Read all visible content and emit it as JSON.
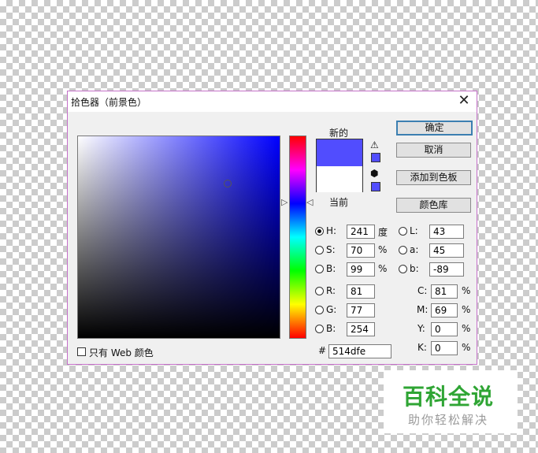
{
  "dialog": {
    "title": "拾色器（前景色）",
    "close_symbol": "✕"
  },
  "swatch": {
    "new_label": "新的",
    "current_label": "当前",
    "new_color": "#514dfe",
    "current_color": "#ffffff"
  },
  "buttons": {
    "ok": "确定",
    "cancel": "取消",
    "add_to_swatches": "添加到色板",
    "color_libraries": "颜色库"
  },
  "hsb": {
    "h_label": "H:",
    "h_value": "241",
    "h_unit": "度",
    "s_label": "S:",
    "s_value": "70",
    "s_unit": "%",
    "b_label": "B:",
    "b_value": "99",
    "b_unit": "%"
  },
  "rgb": {
    "r_label": "R:",
    "r_value": "81",
    "g_label": "G:",
    "g_value": "77",
    "b_label": "B:",
    "b_value": "254"
  },
  "lab": {
    "l_label": "L:",
    "l_value": "43",
    "a_label": "a:",
    "a_value": "45",
    "b_label": "b:",
    "b_value": "-89"
  },
  "cmyk": {
    "c_label": "C:",
    "c_value": "81",
    "c_unit": "%",
    "m_label": "M:",
    "m_value": "69",
    "m_unit": "%",
    "y_label": "Y:",
    "y_value": "0",
    "y_unit": "%",
    "k_label": "K:",
    "k_value": "0",
    "k_unit": "%"
  },
  "hex": {
    "label": "#",
    "value": "514dfe"
  },
  "web_only": {
    "label": "只有 Web 颜色",
    "checked": false
  },
  "icons": {
    "warning": "warning-icon",
    "cube": "web-safe-cube-icon"
  },
  "watermark": {
    "title": "百科全说",
    "subtitle": "助你轻松解决"
  }
}
